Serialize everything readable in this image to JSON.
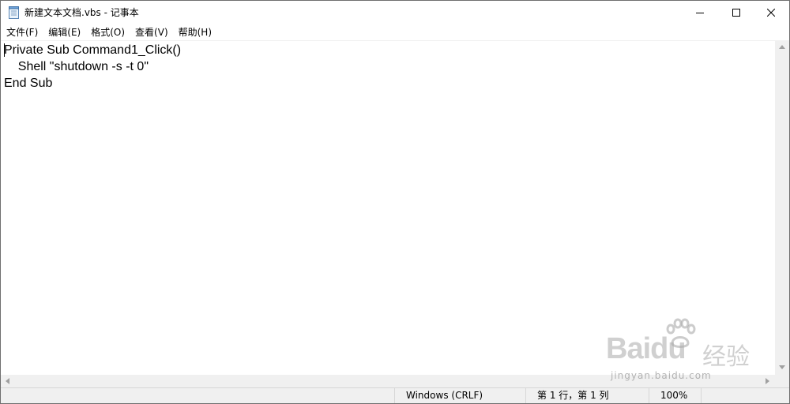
{
  "window": {
    "title": "新建文本文档.vbs - 记事本"
  },
  "menu": [
    {
      "label": "文件(F)"
    },
    {
      "label": "编辑(E)"
    },
    {
      "label": "格式(O)"
    },
    {
      "label": "查看(V)"
    },
    {
      "label": "帮助(H)"
    }
  ],
  "editor": {
    "content": "Private Sub Command1_Click()\n    Shell \"shutdown -s -t 0\"\nEnd Sub"
  },
  "status": {
    "line_ending": "Windows (CRLF)",
    "position": "第 1 行，第 1 列",
    "zoom": "100%"
  },
  "watermark": {
    "brand": "Baidu",
    "cn": "经验",
    "url": "jingyan.baidu.com"
  },
  "icons": {
    "app": "notepad-icon",
    "minimize": "minimize-icon",
    "maximize": "maximize-icon",
    "close": "close-icon"
  }
}
